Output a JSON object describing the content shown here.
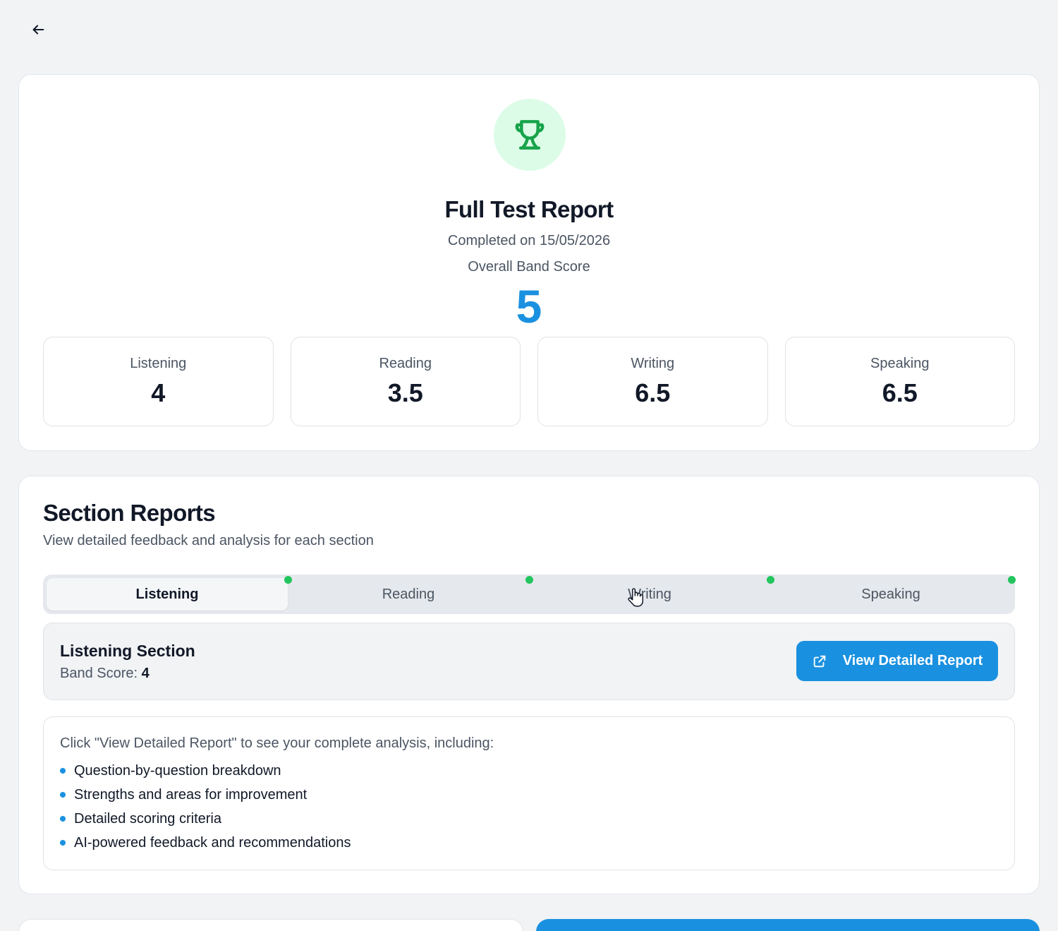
{
  "header": {
    "back_icon": "arrow-left-icon"
  },
  "summary": {
    "icon": "trophy-icon",
    "title": "Full Test Report",
    "completed": "Completed on 15/05/2026",
    "overall_label": "Overall Band Score",
    "overall_score": "5",
    "scores": [
      {
        "label": "Listening",
        "value": "4"
      },
      {
        "label": "Reading",
        "value": "3.5"
      },
      {
        "label": "Writing",
        "value": "6.5"
      },
      {
        "label": "Speaking",
        "value": "6.5"
      }
    ]
  },
  "sections": {
    "title": "Section Reports",
    "subtitle": "View detailed feedback and analysis for each section",
    "tabs": [
      {
        "label": "Listening",
        "active": true,
        "completed": true
      },
      {
        "label": "Reading",
        "active": false,
        "completed": true
      },
      {
        "label": "Writing",
        "active": false,
        "completed": true
      },
      {
        "label": "Speaking",
        "active": false,
        "completed": true
      }
    ],
    "panel": {
      "name": "Listening Section",
      "band_label": "Band Score:",
      "band_value": "4",
      "button_label": "View Detailed Report",
      "button_icon": "external-link-icon"
    },
    "info": {
      "intro": "Click \"View Detailed Report\" to see your complete analysis, including:",
      "items": [
        "Question-by-question breakdown",
        "Strengths and areas for improvement",
        "Detailed scoring criteria",
        "AI-powered feedback and recommendations"
      ]
    }
  },
  "colors": {
    "accent": "#1a91e0",
    "success": "#22c55e",
    "trophy_bg": "#dcfce7",
    "trophy": "#16a34a"
  }
}
